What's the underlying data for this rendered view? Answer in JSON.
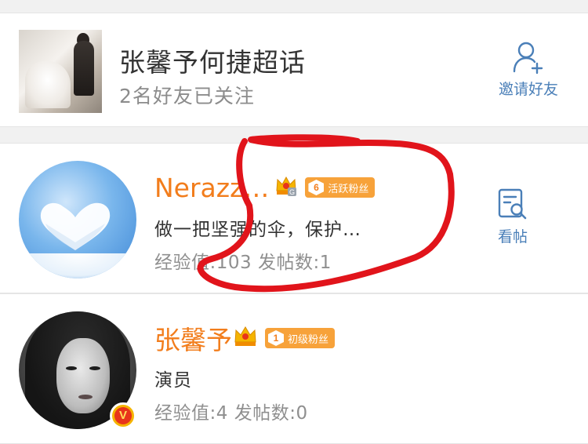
{
  "topic": {
    "title": "张馨予何捷超话",
    "subtitle": "2名好友已关注",
    "invite_label": "邀请好友",
    "thumbnail_icon": "wedding-photo-thumbnail",
    "invite_icon": "add-user-icon"
  },
  "users": [
    {
      "name": "Nerazz…",
      "crown_level": "G",
      "fan_level": "6",
      "fan_label": "活跃粉丝",
      "bio": "做一把坚强的伞，保护…",
      "stats": "经验值:103 发帖数:1",
      "action_label": "看帖",
      "action_icon": "view-posts-icon",
      "avatar_icon": "heart-cloud-avatar"
    },
    {
      "name": "张馨予",
      "fan_level": "1",
      "fan_label": "初级粉丝",
      "bio": "演员",
      "stats": "经验值:4 发帖数:0",
      "verified_badge": "V",
      "avatar_icon": "portrait-avatar"
    }
  ],
  "colors": {
    "name_orange": "#f27d1c",
    "link_blue": "#4a7fb8",
    "badge_orange": "#f7a23a",
    "marker_red": "#e1141b"
  }
}
